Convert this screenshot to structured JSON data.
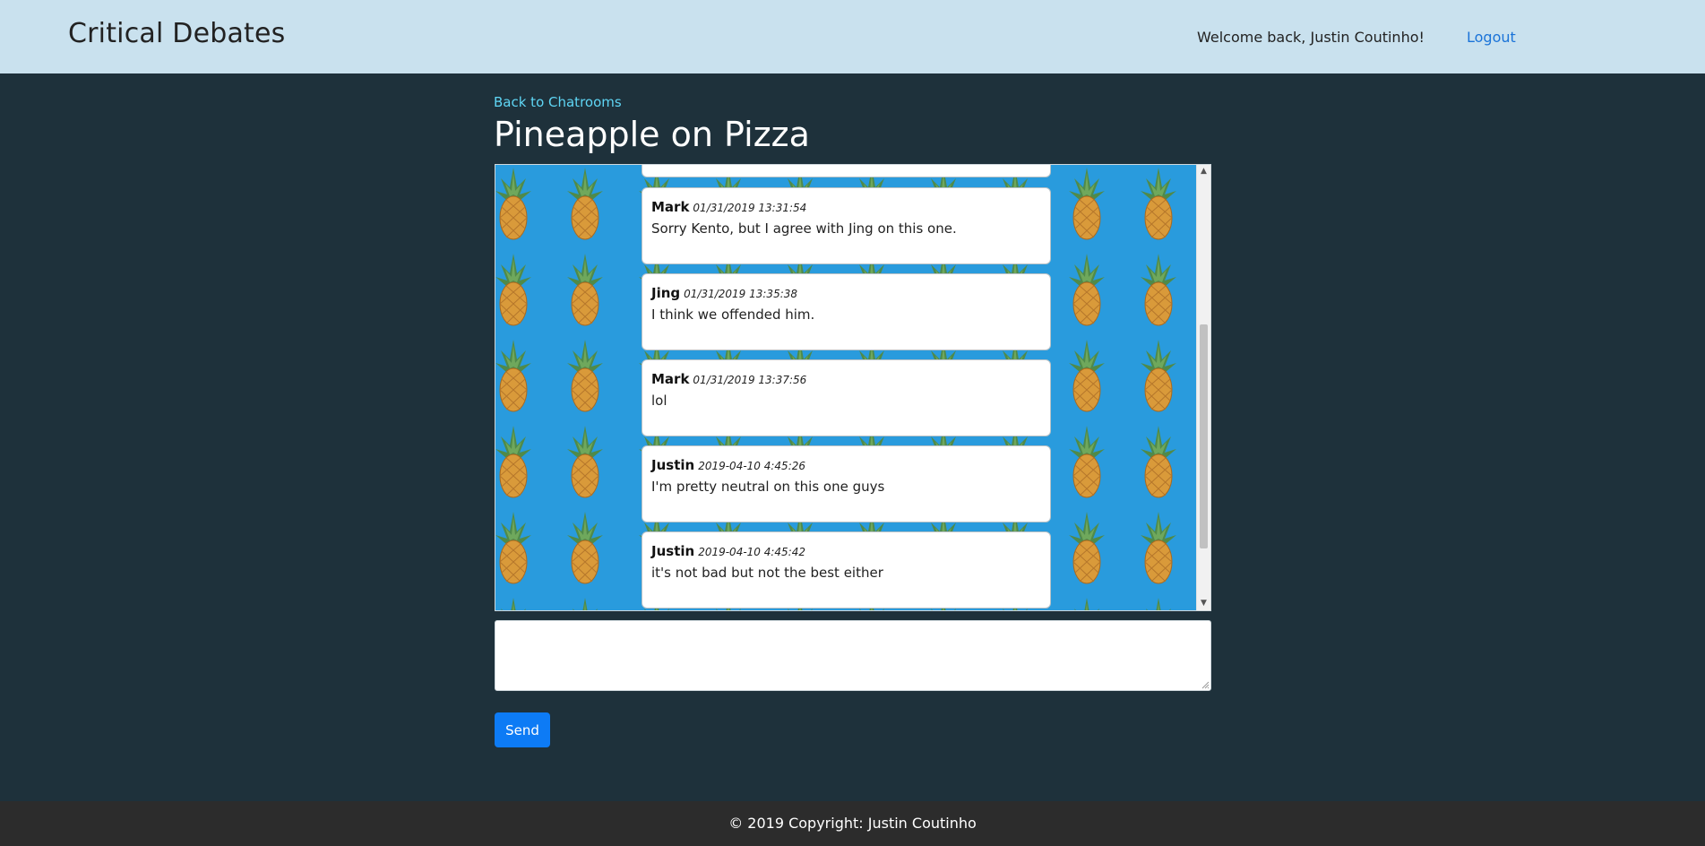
{
  "navbar": {
    "brand": "Critical Debates",
    "welcome": "Welcome back, Justin Coutinho!",
    "logout": "Logout"
  },
  "chatroom": {
    "back_link": "Back to Chatrooms",
    "title": "Pineapple on Pizza",
    "background": "pineapple-pattern",
    "messages": [
      {
        "user": "Mark",
        "time": "01/31/2019 13:31:54",
        "text": "Sorry Kento, but I agree with Jing on this one."
      },
      {
        "user": "Jing",
        "time": "01/31/2019 13:35:38",
        "text": "I think we offended him."
      },
      {
        "user": "Mark",
        "time": "01/31/2019 13:37:56",
        "text": "lol"
      },
      {
        "user": "Justin",
        "time": "2019-04-10 4:45:26",
        "text": "I'm pretty neutral on this one guys"
      },
      {
        "user": "Justin",
        "time": "2019-04-10 4:45:42",
        "text": "it's not bad but not the best either"
      }
    ]
  },
  "composer": {
    "value": "",
    "send_label": "Send"
  },
  "footer": {
    "copyright": "© 2019 Copyright: Justin Coutinho"
  },
  "colors": {
    "navbar": "#c9e1ee",
    "page_background": "#1e313b",
    "accent_link": "#5fd6f5",
    "button": "#0d7bf5",
    "footer": "#2c2c2c"
  }
}
